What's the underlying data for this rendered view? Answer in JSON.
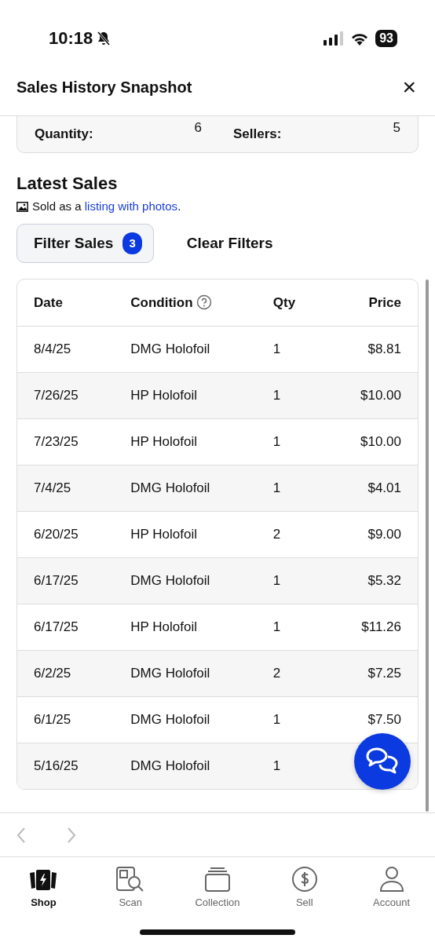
{
  "status_bar": {
    "time": "10:18",
    "battery": "93"
  },
  "header": {
    "title": "Sales History Snapshot",
    "close": "×"
  },
  "stats": [
    {
      "label": "Quantity:",
      "value": "6"
    },
    {
      "label": "Sellers:",
      "value": "5"
    }
  ],
  "latest_sales": {
    "title": "Latest Sales",
    "note_prefix": "Sold as a",
    "note_link": "listing with photos",
    "note_suffix": "."
  },
  "filters": {
    "filter_button": "Filter Sales",
    "filter_count": "3",
    "clear_button": "Clear Filters"
  },
  "table": {
    "columns": [
      "Date",
      "Condition",
      "Qty",
      "Price"
    ],
    "rows": [
      {
        "date": "8/4/25",
        "condition": "DMG Holofoil",
        "qty": "1",
        "price": "$8.81"
      },
      {
        "date": "7/26/25",
        "condition": "HP Holofoil",
        "qty": "1",
        "price": "$10.00"
      },
      {
        "date": "7/23/25",
        "condition": "HP Holofoil",
        "qty": "1",
        "price": "$10.00"
      },
      {
        "date": "7/4/25",
        "condition": "DMG Holofoil",
        "qty": "1",
        "price": "$4.01"
      },
      {
        "date": "6/20/25",
        "condition": "HP Holofoil",
        "qty": "2",
        "price": "$9.00"
      },
      {
        "date": "6/17/25",
        "condition": "DMG Holofoil",
        "qty": "1",
        "price": "$5.32"
      },
      {
        "date": "6/17/25",
        "condition": "HP Holofoil",
        "qty": "1",
        "price": "$11.26"
      },
      {
        "date": "6/2/25",
        "condition": "DMG Holofoil",
        "qty": "2",
        "price": "$7.25"
      },
      {
        "date": "6/1/25",
        "condition": "DMG Holofoil",
        "qty": "1",
        "price": "$7.50"
      },
      {
        "date": "5/16/25",
        "condition": "DMG Holofoil",
        "qty": "1"
      }
    ]
  },
  "tab_bar": [
    {
      "label": "Shop",
      "kind": "shop",
      "selected": true
    },
    {
      "label": "Scan",
      "kind": "scan",
      "selected": false
    },
    {
      "label": "Collection",
      "kind": "collection",
      "selected": false
    },
    {
      "label": "Sell",
      "kind": "sell",
      "selected": false
    },
    {
      "label": "Account",
      "kind": "account",
      "selected": false
    }
  ]
}
